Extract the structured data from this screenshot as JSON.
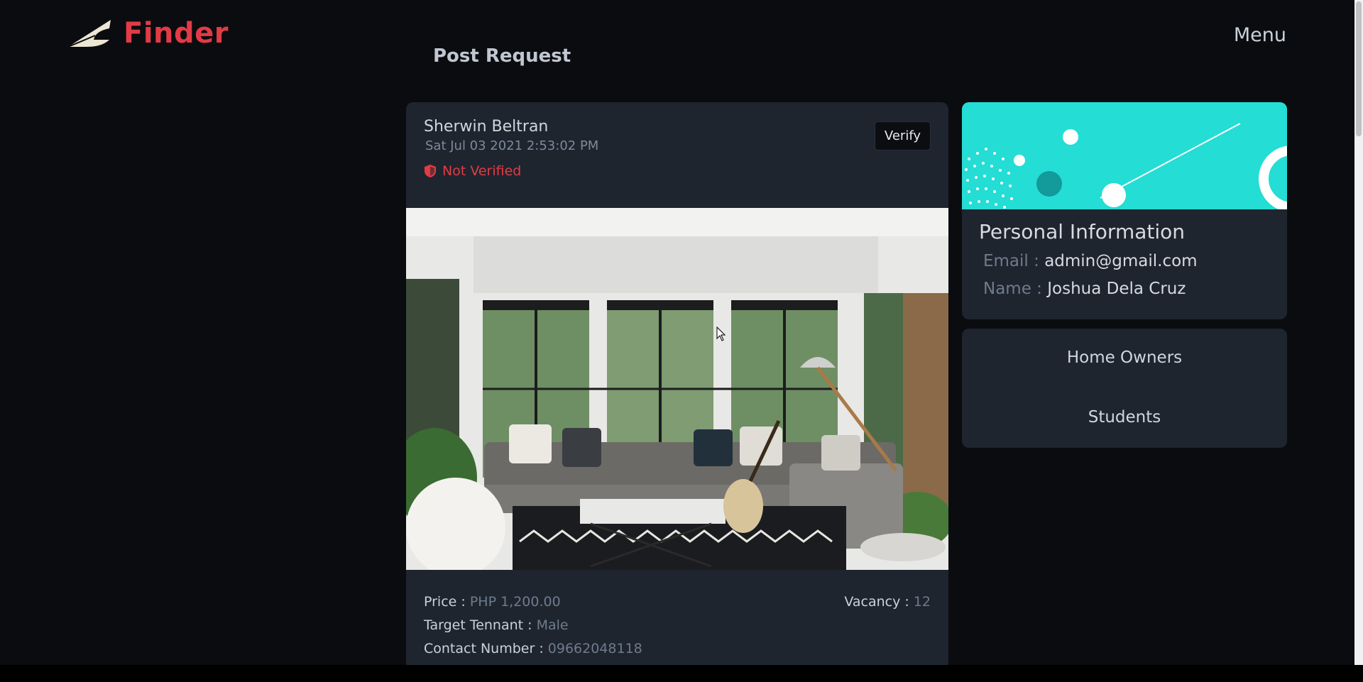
{
  "header": {
    "logo_text": "Finder",
    "menu_label": "Menu",
    "page_title": "Post Request"
  },
  "post": {
    "poster_name": "Sherwin Beltran",
    "date": "Sat Jul 03 2021 2:53:02 PM",
    "status": "Not Verified",
    "verify_label": "Verify",
    "price_label": "Price :",
    "price_value": "PHP 1,200.00",
    "target_label": "Target Tennant :",
    "target_value": "Male",
    "contact_label": "Contact Number :",
    "contact_value": "09662048118",
    "vacancy_label": "Vacancy :",
    "vacancy_value": "12",
    "photo_icon": "living-room-photo"
  },
  "profile": {
    "title": "Personal Information",
    "email_label": "Email :",
    "email_value": "admin@gmail.com",
    "name_label": "Name :",
    "name_value": "Joshua Dela Cruz"
  },
  "nav": {
    "items": [
      {
        "label": "Home Owners"
      },
      {
        "label": "Students"
      }
    ]
  },
  "colors": {
    "background": "#0a0c10",
    "card": "#1f252e",
    "brand_red": "#e23b45",
    "banner_teal": "#24ddd4",
    "muted_value": "#6e7b8f"
  }
}
